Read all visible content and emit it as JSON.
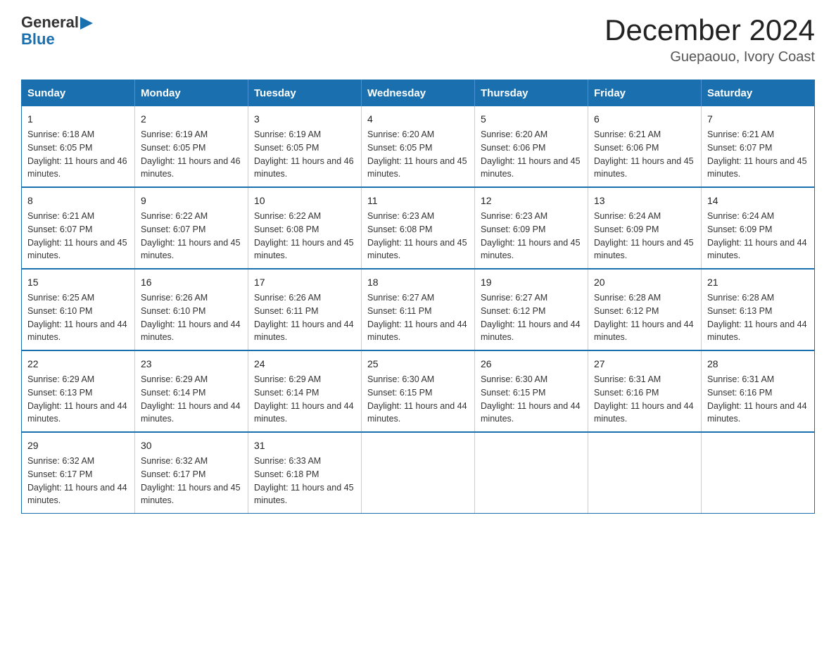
{
  "logo": {
    "general": "General",
    "blue": "Blue",
    "arrow": "▶"
  },
  "title": "December 2024",
  "subtitle": "Guepaouo, Ivory Coast",
  "days_of_week": [
    "Sunday",
    "Monday",
    "Tuesday",
    "Wednesday",
    "Thursday",
    "Friday",
    "Saturday"
  ],
  "weeks": [
    [
      {
        "day": "1",
        "sunrise": "6:18 AM",
        "sunset": "6:05 PM",
        "daylight": "11 hours and 46 minutes."
      },
      {
        "day": "2",
        "sunrise": "6:19 AM",
        "sunset": "6:05 PM",
        "daylight": "11 hours and 46 minutes."
      },
      {
        "day": "3",
        "sunrise": "6:19 AM",
        "sunset": "6:05 PM",
        "daylight": "11 hours and 46 minutes."
      },
      {
        "day": "4",
        "sunrise": "6:20 AM",
        "sunset": "6:05 PM",
        "daylight": "11 hours and 45 minutes."
      },
      {
        "day": "5",
        "sunrise": "6:20 AM",
        "sunset": "6:06 PM",
        "daylight": "11 hours and 45 minutes."
      },
      {
        "day": "6",
        "sunrise": "6:21 AM",
        "sunset": "6:06 PM",
        "daylight": "11 hours and 45 minutes."
      },
      {
        "day": "7",
        "sunrise": "6:21 AM",
        "sunset": "6:07 PM",
        "daylight": "11 hours and 45 minutes."
      }
    ],
    [
      {
        "day": "8",
        "sunrise": "6:21 AM",
        "sunset": "6:07 PM",
        "daylight": "11 hours and 45 minutes."
      },
      {
        "day": "9",
        "sunrise": "6:22 AM",
        "sunset": "6:07 PM",
        "daylight": "11 hours and 45 minutes."
      },
      {
        "day": "10",
        "sunrise": "6:22 AM",
        "sunset": "6:08 PM",
        "daylight": "11 hours and 45 minutes."
      },
      {
        "day": "11",
        "sunrise": "6:23 AM",
        "sunset": "6:08 PM",
        "daylight": "11 hours and 45 minutes."
      },
      {
        "day": "12",
        "sunrise": "6:23 AM",
        "sunset": "6:09 PM",
        "daylight": "11 hours and 45 minutes."
      },
      {
        "day": "13",
        "sunrise": "6:24 AM",
        "sunset": "6:09 PM",
        "daylight": "11 hours and 45 minutes."
      },
      {
        "day": "14",
        "sunrise": "6:24 AM",
        "sunset": "6:09 PM",
        "daylight": "11 hours and 44 minutes."
      }
    ],
    [
      {
        "day": "15",
        "sunrise": "6:25 AM",
        "sunset": "6:10 PM",
        "daylight": "11 hours and 44 minutes."
      },
      {
        "day": "16",
        "sunrise": "6:26 AM",
        "sunset": "6:10 PM",
        "daylight": "11 hours and 44 minutes."
      },
      {
        "day": "17",
        "sunrise": "6:26 AM",
        "sunset": "6:11 PM",
        "daylight": "11 hours and 44 minutes."
      },
      {
        "day": "18",
        "sunrise": "6:27 AM",
        "sunset": "6:11 PM",
        "daylight": "11 hours and 44 minutes."
      },
      {
        "day": "19",
        "sunrise": "6:27 AM",
        "sunset": "6:12 PM",
        "daylight": "11 hours and 44 minutes."
      },
      {
        "day": "20",
        "sunrise": "6:28 AM",
        "sunset": "6:12 PM",
        "daylight": "11 hours and 44 minutes."
      },
      {
        "day": "21",
        "sunrise": "6:28 AM",
        "sunset": "6:13 PM",
        "daylight": "11 hours and 44 minutes."
      }
    ],
    [
      {
        "day": "22",
        "sunrise": "6:29 AM",
        "sunset": "6:13 PM",
        "daylight": "11 hours and 44 minutes."
      },
      {
        "day": "23",
        "sunrise": "6:29 AM",
        "sunset": "6:14 PM",
        "daylight": "11 hours and 44 minutes."
      },
      {
        "day": "24",
        "sunrise": "6:29 AM",
        "sunset": "6:14 PM",
        "daylight": "11 hours and 44 minutes."
      },
      {
        "day": "25",
        "sunrise": "6:30 AM",
        "sunset": "6:15 PM",
        "daylight": "11 hours and 44 minutes."
      },
      {
        "day": "26",
        "sunrise": "6:30 AM",
        "sunset": "6:15 PM",
        "daylight": "11 hours and 44 minutes."
      },
      {
        "day": "27",
        "sunrise": "6:31 AM",
        "sunset": "6:16 PM",
        "daylight": "11 hours and 44 minutes."
      },
      {
        "day": "28",
        "sunrise": "6:31 AM",
        "sunset": "6:16 PM",
        "daylight": "11 hours and 44 minutes."
      }
    ],
    [
      {
        "day": "29",
        "sunrise": "6:32 AM",
        "sunset": "6:17 PM",
        "daylight": "11 hours and 44 minutes."
      },
      {
        "day": "30",
        "sunrise": "6:32 AM",
        "sunset": "6:17 PM",
        "daylight": "11 hours and 45 minutes."
      },
      {
        "day": "31",
        "sunrise": "6:33 AM",
        "sunset": "6:18 PM",
        "daylight": "11 hours and 45 minutes."
      },
      null,
      null,
      null,
      null
    ]
  ]
}
